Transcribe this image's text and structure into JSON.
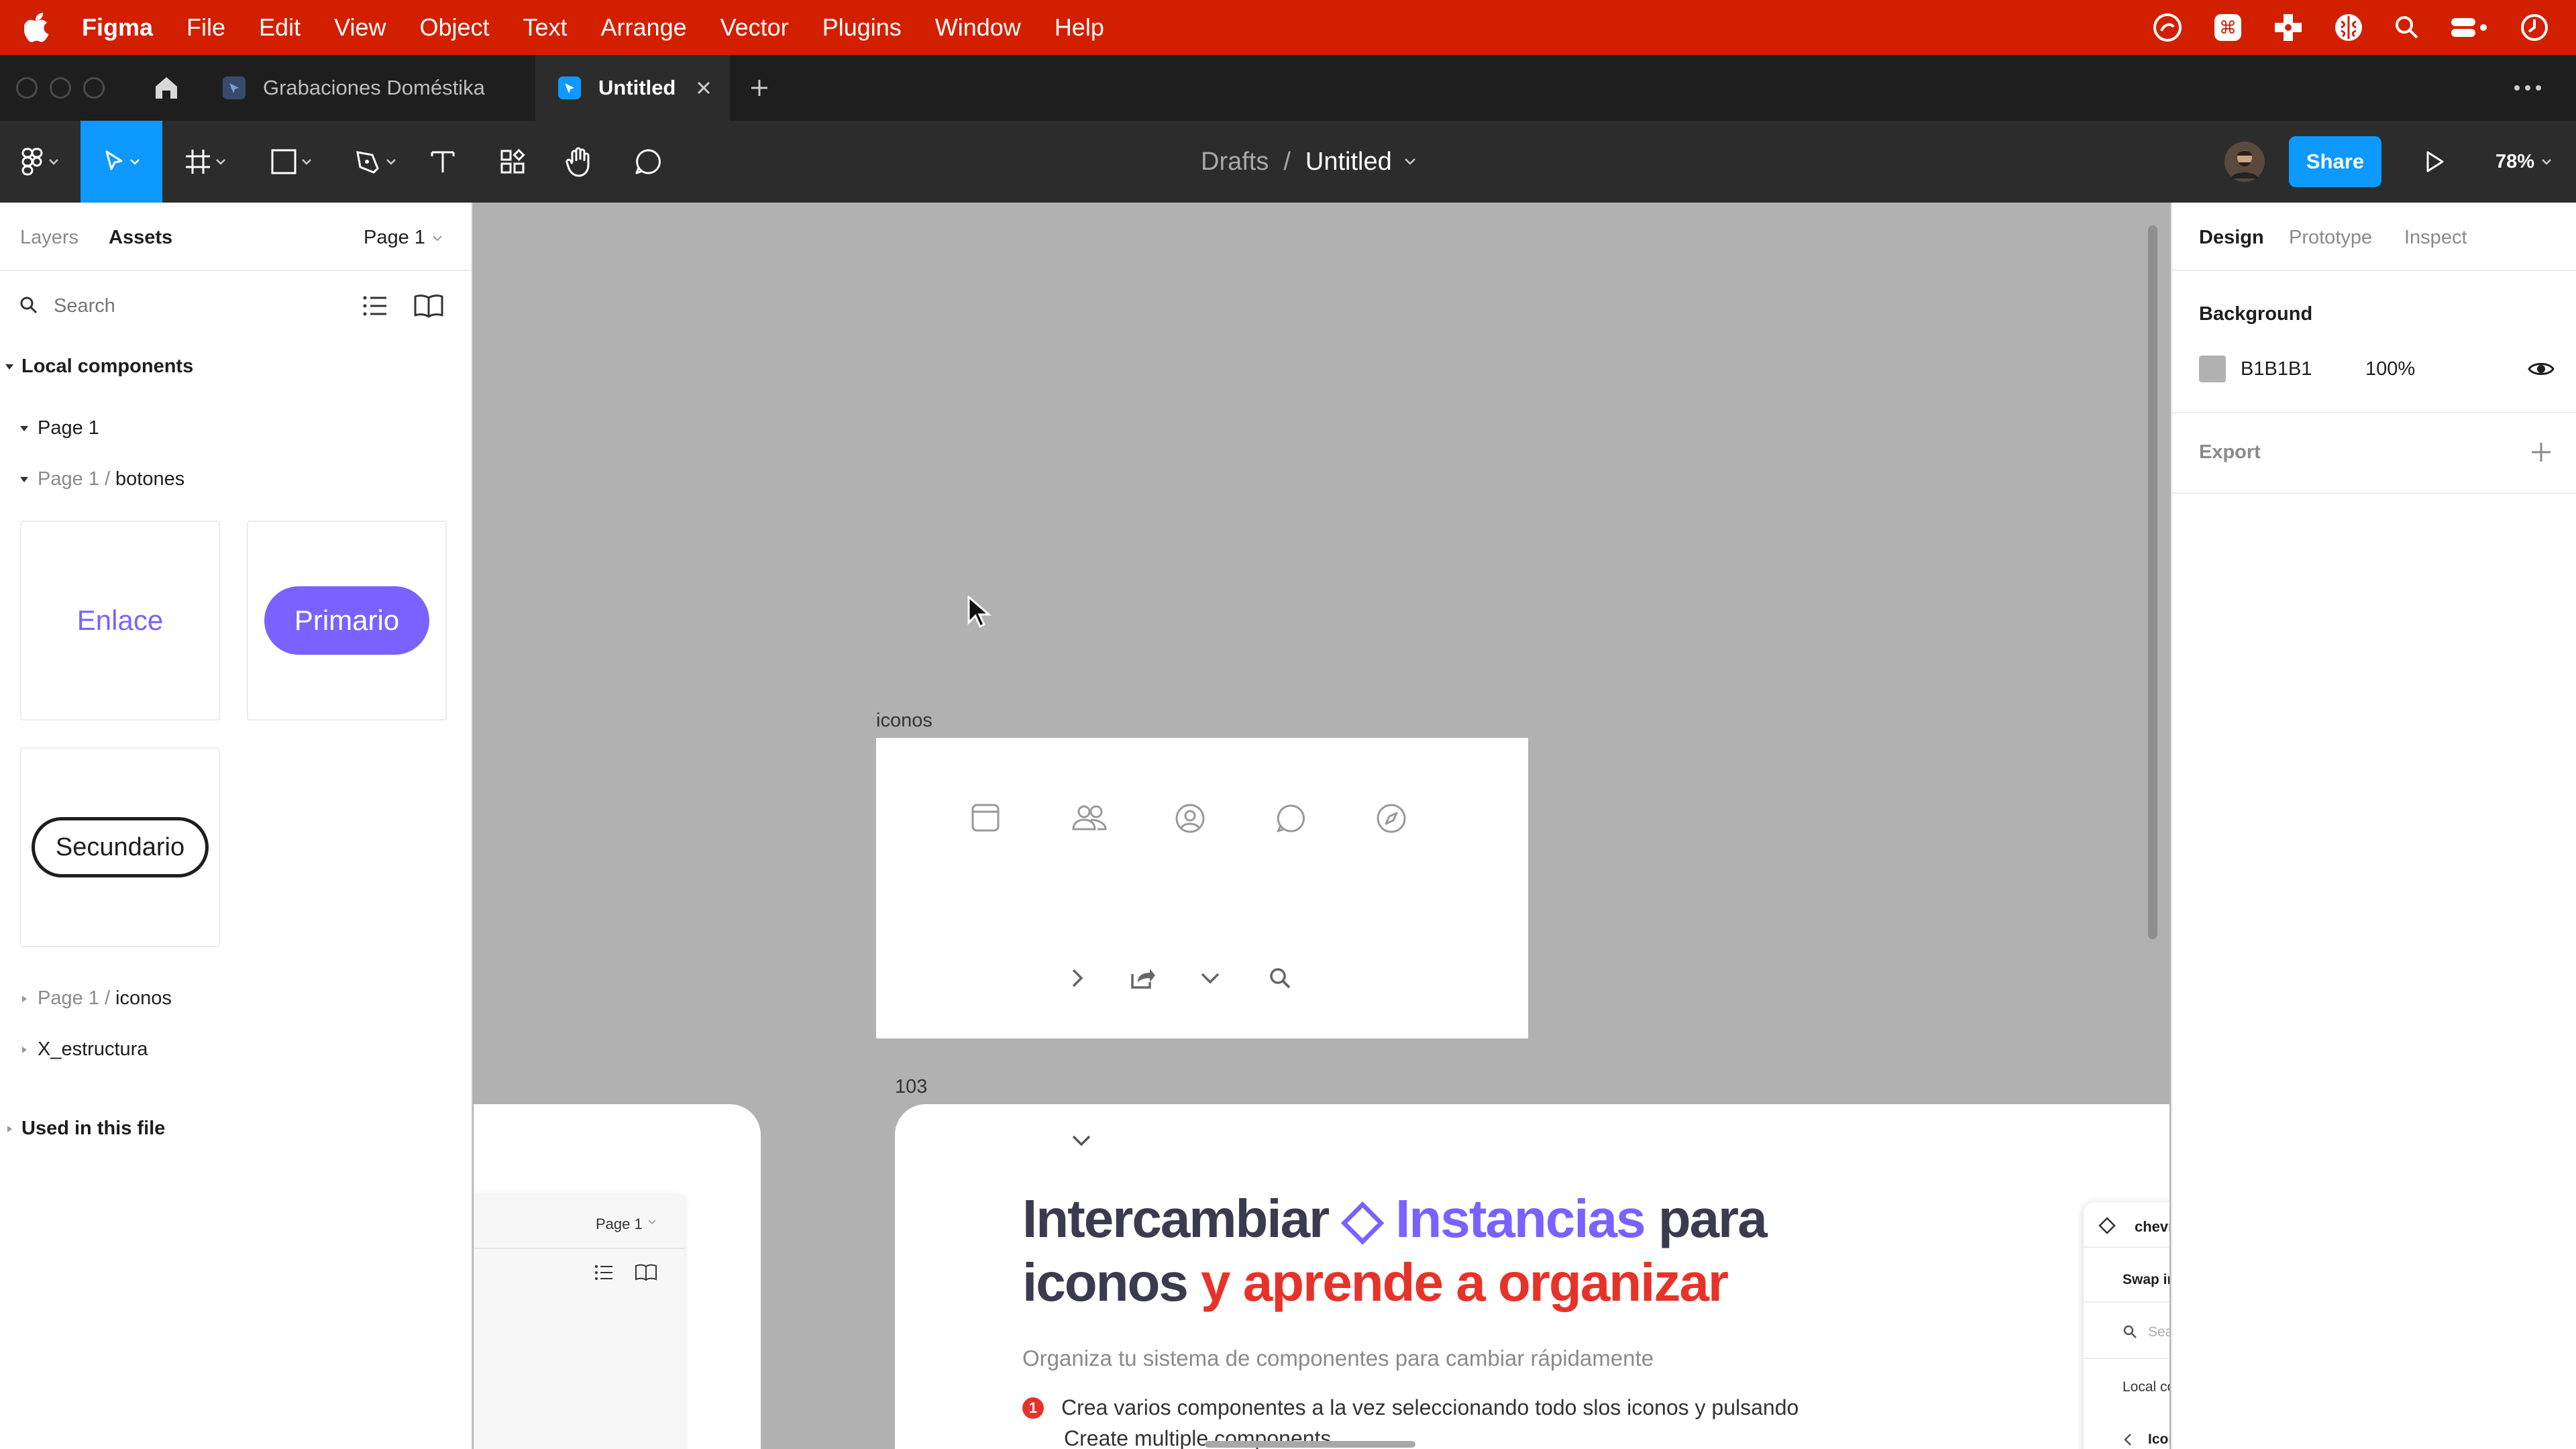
{
  "menubar": {
    "app": "Figma",
    "items": [
      "File",
      "Edit",
      "View",
      "Object",
      "Text",
      "Arrange",
      "Vector",
      "Plugins",
      "Window",
      "Help"
    ]
  },
  "tabs": {
    "tab1": "Grabaciones Doméstika",
    "tab2": "Untitled"
  },
  "toolbar": {
    "crumb_root": "Drafts",
    "crumb_sep": "/",
    "crumb_file": "Untitled",
    "share": "Share",
    "zoom": "78%"
  },
  "left": {
    "tab_layers": "Layers",
    "tab_assets": "Assets",
    "page_select": "Page 1",
    "search_placeholder": "Search",
    "local_components": "Local components",
    "page1": "Page 1",
    "botones_prefix": "Page 1 / ",
    "botones": "botones",
    "btn_enlace": "Enlace",
    "btn_primario": "Primario",
    "btn_secundario": "Secundario",
    "iconos_prefix": "Page 1 / ",
    "iconos": "iconos",
    "estructura": "X_estructura",
    "used_in_file": "Used in this file"
  },
  "right": {
    "tab_design": "Design",
    "tab_prototype": "Prototype",
    "tab_inspect": "Inspect",
    "background_label": "Background",
    "bg_hex": "B1B1B1",
    "bg_opacity": "100%",
    "export_label": "Export"
  },
  "canvas": {
    "frame_iconos_label": "iconos",
    "frame_103_label": "103",
    "video_page_select": "Page 1",
    "headline_part1": "Intercambiar ",
    "headline_part2": "◇ Instancias",
    "headline_part3": " para",
    "headline_line2a": "iconos ",
    "headline_line2b": "y aprende a organizar",
    "subhead": "Organiza tu sistema de componentes para cambiar rápidamente",
    "bullet_num": "1",
    "bullet_text": "Crea varios componentes a la vez seleccionando todo slos iconos y pulsando",
    "bullet_text2": "Create multiple components",
    "popup_title": "chevron-",
    "popup_swap": "Swap insta",
    "popup_search": "Search",
    "popup_local": "Local comp",
    "popup_icons": "Icons"
  },
  "colors": {
    "menubar": "#d21f00",
    "accent": "#0d99ff",
    "primary_button": "#7b61ff",
    "canvas_bg": "#b1b1b1"
  }
}
